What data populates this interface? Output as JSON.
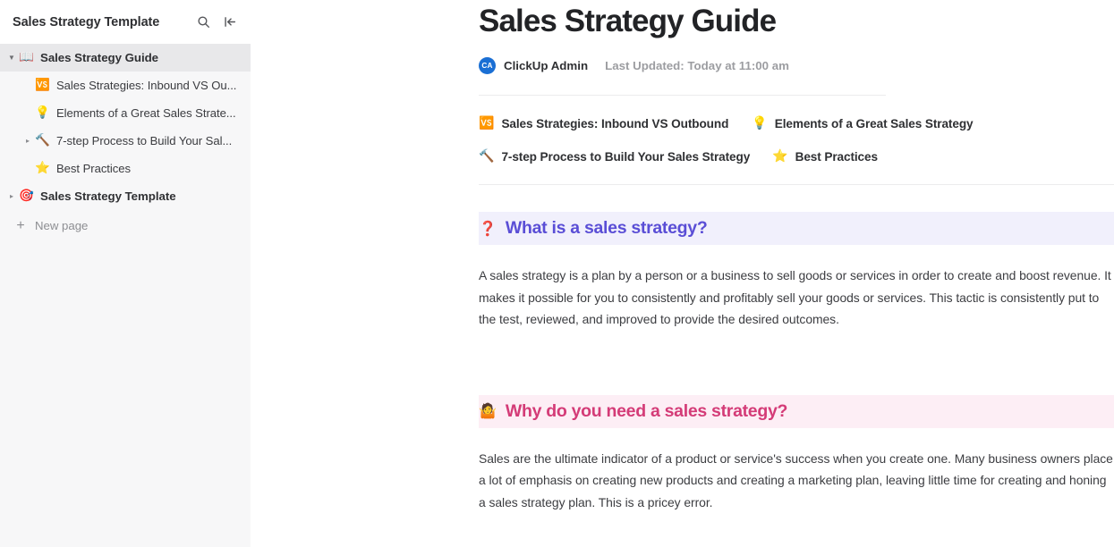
{
  "sidebar": {
    "title": "Sales Strategy Template",
    "actions": [
      {
        "name": "search-icon",
        "label": "Search"
      },
      {
        "name": "collapse-sidebar-icon",
        "label": "Collapse sidebar"
      }
    ],
    "tree": [
      {
        "label": "Sales Strategy Guide",
        "emoji": "📖",
        "icon_name": "open-book-icon",
        "level": 1,
        "caret": "open",
        "selected": true,
        "bold": true
      },
      {
        "label": "Sales Strategies: Inbound VS Ou...",
        "emoji": "🆚",
        "icon_name": "vs-badge-icon",
        "level": 2,
        "caret": "none",
        "selected": false,
        "bold": false
      },
      {
        "label": "Elements of a Great Sales Strate...",
        "emoji": "💡",
        "icon_name": "light-bulb-icon",
        "level": 2,
        "caret": "none",
        "selected": false,
        "bold": false
      },
      {
        "label": "7-step Process to Build Your Sal...",
        "emoji": "🔨",
        "icon_name": "hammer-icon",
        "level": 2,
        "caret": "closed",
        "selected": false,
        "bold": false
      },
      {
        "label": "Best Practices",
        "emoji": "⭐",
        "icon_name": "star-icon",
        "level": 2,
        "caret": "none",
        "selected": false,
        "bold": false
      },
      {
        "label": "Sales Strategy Template",
        "emoji": "🎯",
        "icon_name": "dart-target-icon",
        "level": 1,
        "caret": "closed",
        "selected": false,
        "bold": true
      }
    ],
    "new_page_label": "New page"
  },
  "document": {
    "title": "Sales Strategy Guide",
    "author_initials": "CA",
    "author": "ClickUp Admin",
    "last_updated": "Last Updated: Today at 11:00 am",
    "quick_links": [
      {
        "label": "Sales Strategies: Inbound VS Outbound",
        "emoji": "🆚",
        "icon_name": "vs-badge-icon"
      },
      {
        "label": "Elements of a Great Sales Strategy",
        "emoji": "💡",
        "icon_name": "light-bulb-icon"
      },
      {
        "label": "7-step Process to Build Your Sales Strategy",
        "emoji": "🔨",
        "icon_name": "hammer-icon"
      },
      {
        "label": "Best Practices",
        "emoji": "⭐",
        "icon_name": "star-icon"
      }
    ],
    "sections": [
      {
        "heading": "What is a sales strategy?",
        "emoji": "❓",
        "icon_name": "red-question-mark-icon",
        "heading_color": "#5a4ed6",
        "heading_bg": "#f1f0fc",
        "body": "A sales strategy is a plan by a person or a business to sell goods or services in order to create and boost revenue. It makes it possible for you to consistently and profitably sell your goods or services. This tactic is consistently put to the test, reviewed, and improved to provide the desired outcomes."
      },
      {
        "heading": "Why do you need a sales strategy?",
        "emoji": "🤷",
        "icon_name": "shrug-person-icon",
        "heading_color": "#d43b77",
        "heading_bg": "#fdeef5",
        "body": "Sales are the ultimate indicator of a product or service's success when you create one. Many business owners place a lot of emphasis on creating new products and creating a marketing plan, leaving little time for creating and honing a sales strategy plan. This is a pricey error."
      }
    ]
  }
}
